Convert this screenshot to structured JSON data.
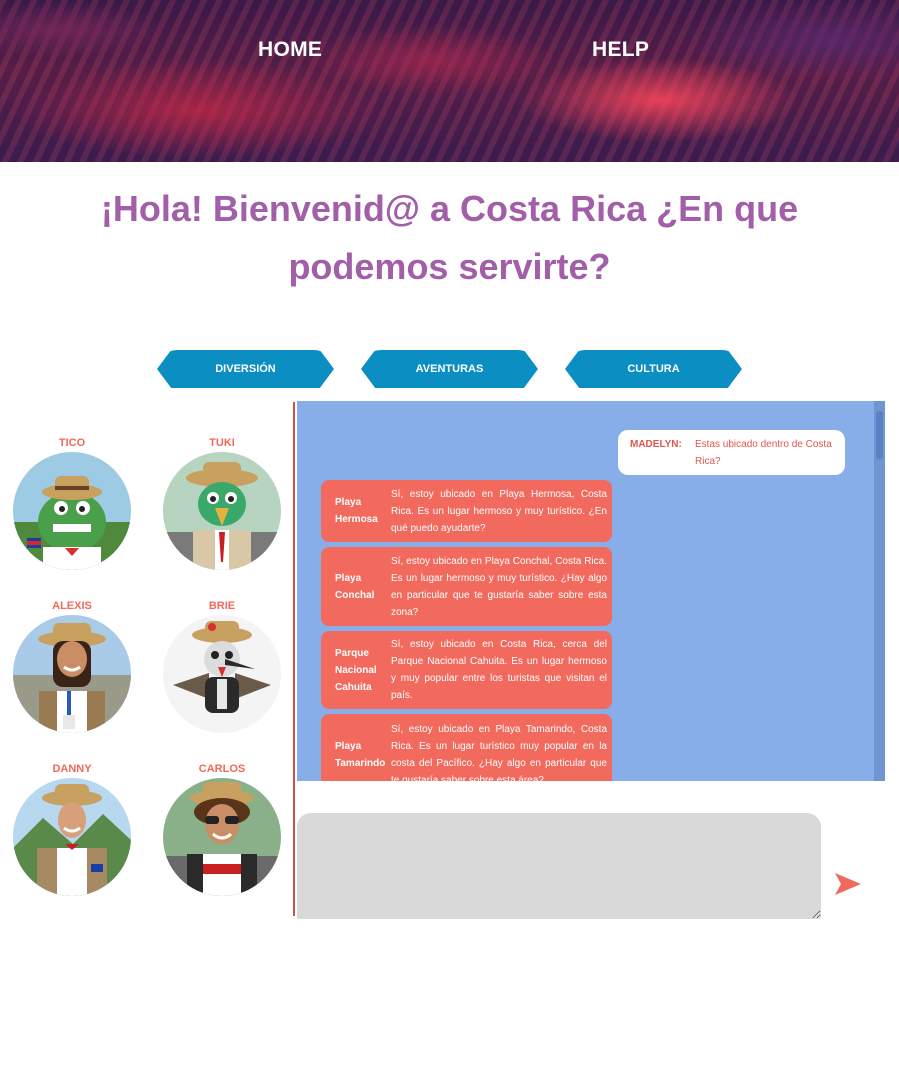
{
  "nav": {
    "home": "HOME",
    "help": "HELP"
  },
  "title": "¡Hola! Bienvenid@ a Costa Rica ¿En que podemos servirte?",
  "categories": [
    "DIVERSIÓN",
    "AVENTURAS",
    "CULTURA"
  ],
  "characters": [
    {
      "name": "TICO",
      "icon": "crocodile-guide-avatar"
    },
    {
      "name": "TUKI",
      "icon": "toucan-guide-avatar"
    },
    {
      "name": "ALEXIS",
      "icon": "woman-guide-avatar"
    },
    {
      "name": "BRIE",
      "icon": "hummingbird-guide-avatar"
    },
    {
      "name": "DANNY",
      "icon": "man-guide-avatar"
    },
    {
      "name": "CARLOS",
      "icon": "curly-man-guide-avatar"
    }
  ],
  "chat": {
    "user": {
      "name": "MADELYN:",
      "text": "Estas ubicado dentro de Costa Rica?"
    },
    "bot_messages": [
      {
        "name": "Playa Hermosa",
        "text": "Sí, estoy ubicado en Playa Hermosa, Costa Rica. Es un lugar hermoso y muy turístico. ¿En qué puedo ayudarte?"
      },
      {
        "name": "Playa Conchal",
        "text": "Sí, estoy ubicado en Playa Conchal, Costa Rica. Es un lugar hermoso y muy turístico. ¿Hay algo en particular que te gustaría saber sobre esta zona?"
      },
      {
        "name": "Parque Nacional Cahuita",
        "text": "Sí, estoy ubicado en Costa Rica, cerca del Parque Nacional Cahuita. Es un lugar hermoso y muy popular entre los turistas que visitan el país."
      },
      {
        "name": "Playa Tamarindo",
        "text": "Sí, estoy ubicado en Playa Tamarindo, Costa Rica. Es un lugar turístico muy popular en la costa del Pacífico. ¿Hay algo en particular que te gustaría saber sobre esta área?"
      }
    ]
  },
  "input": {
    "placeholder": ""
  },
  "colors": {
    "title": "#a25ea8",
    "category_button": "#0b8ec2",
    "chat_panel": "#87aee8",
    "bot_bubble": "#f26a5e",
    "character_name": "#ee6a5a",
    "send_icon": "#ef6a5c"
  },
  "icons": {
    "send": "send-arrow-icon"
  }
}
